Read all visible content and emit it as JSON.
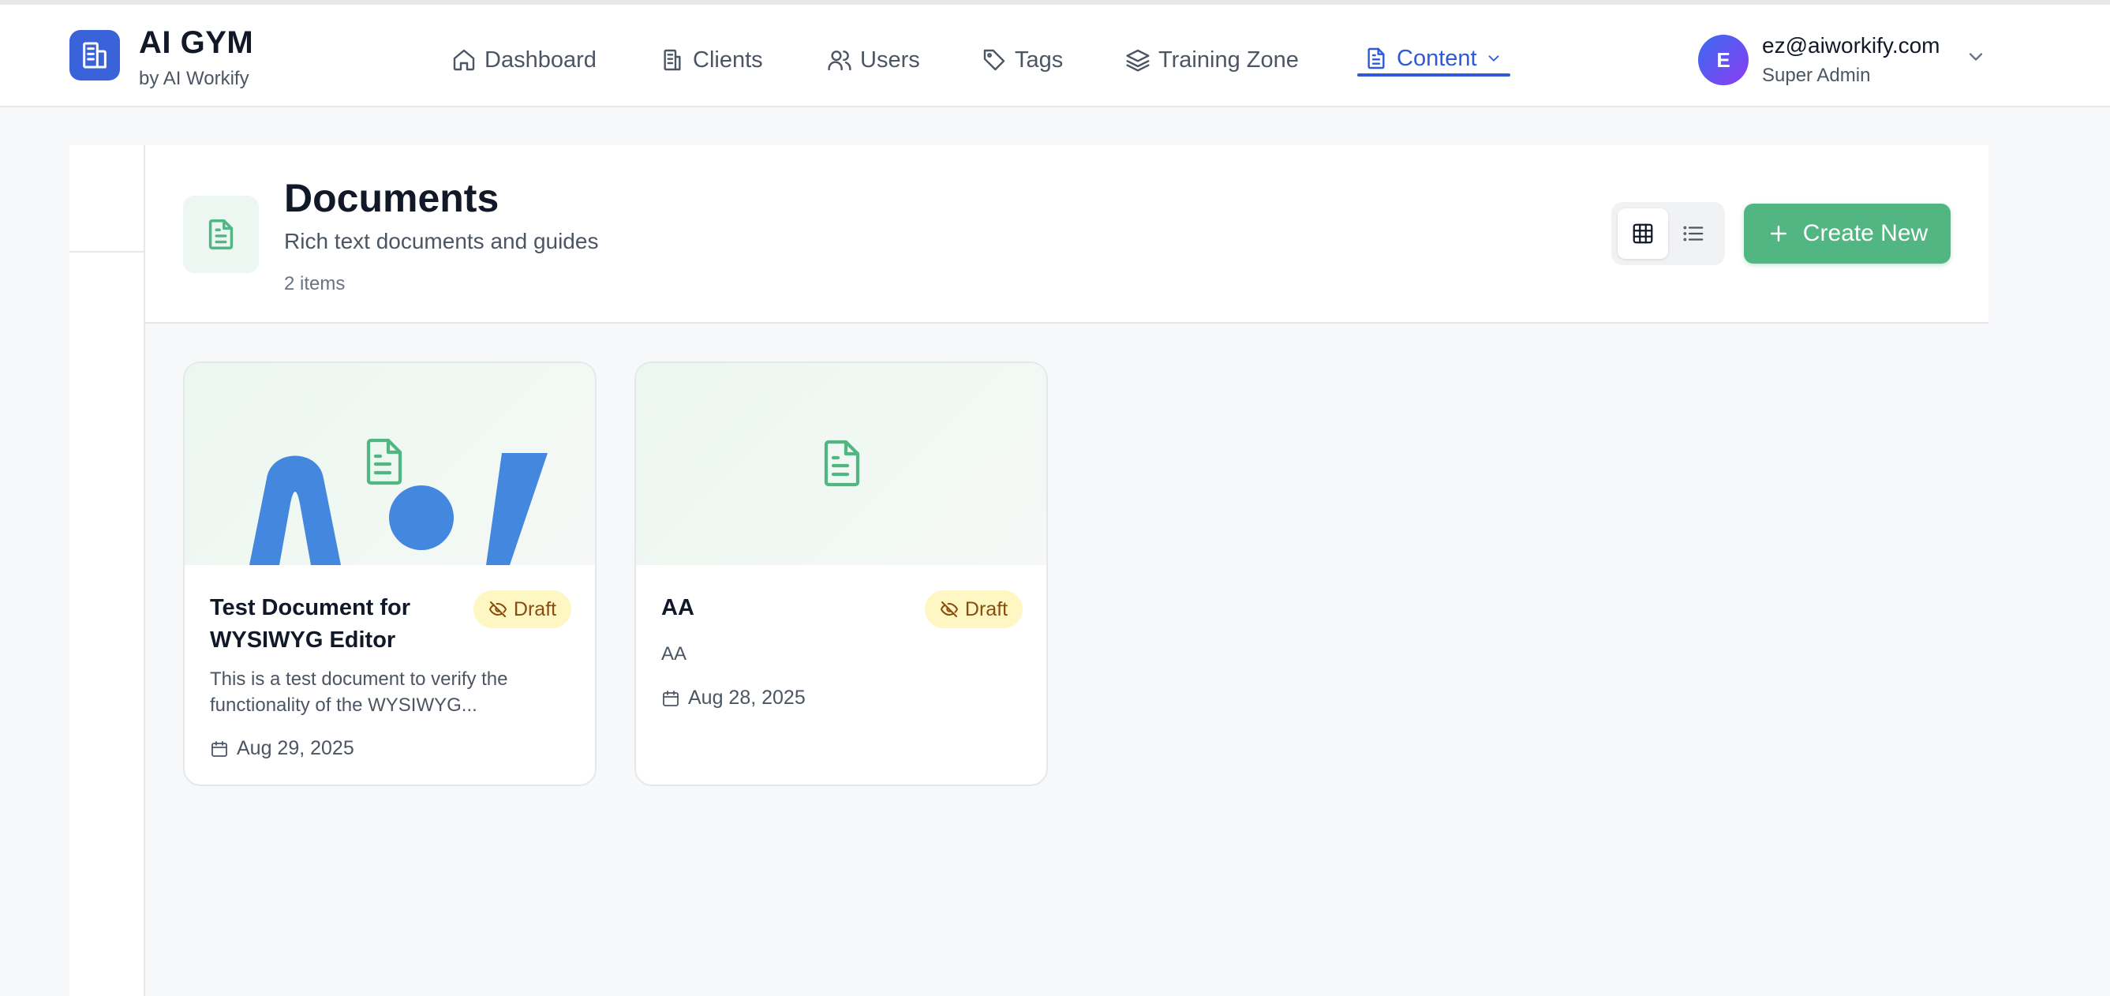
{
  "brand": {
    "title": "AI GYM",
    "subtitle": "by AI Workify",
    "accent": "#3b63d9"
  },
  "nav": {
    "items": [
      {
        "label": "Dashboard",
        "icon": "home-icon"
      },
      {
        "label": "Clients",
        "icon": "building-icon"
      },
      {
        "label": "Users",
        "icon": "users-icon"
      },
      {
        "label": "Tags",
        "icon": "tag-icon"
      },
      {
        "label": "Training Zone",
        "icon": "layers-icon"
      },
      {
        "label": "Content",
        "icon": "document-icon",
        "active": true
      }
    ],
    "active_color": "#2d5ad6"
  },
  "user": {
    "initial": "E",
    "email": "ez@aiworkify.com",
    "role": "Super Admin"
  },
  "header": {
    "title": "Documents",
    "subtitle": "Rich text documents and guides",
    "count": "2 items",
    "view_mode": "grid",
    "create_label": "Create New",
    "create_color": "#52b683"
  },
  "cards": [
    {
      "title": "Test Document for WYSIWYG Editor",
      "description": "This is a test document to verify the functionality of the WYSIWYG...",
      "status": "Draft",
      "date": "Aug 29, 2025",
      "thumbnail": "ai-logo-image"
    },
    {
      "title": "AA",
      "description": "AA",
      "status": "Draft",
      "date": "Aug 28, 2025",
      "thumbnail": "document-placeholder-icon"
    }
  ]
}
